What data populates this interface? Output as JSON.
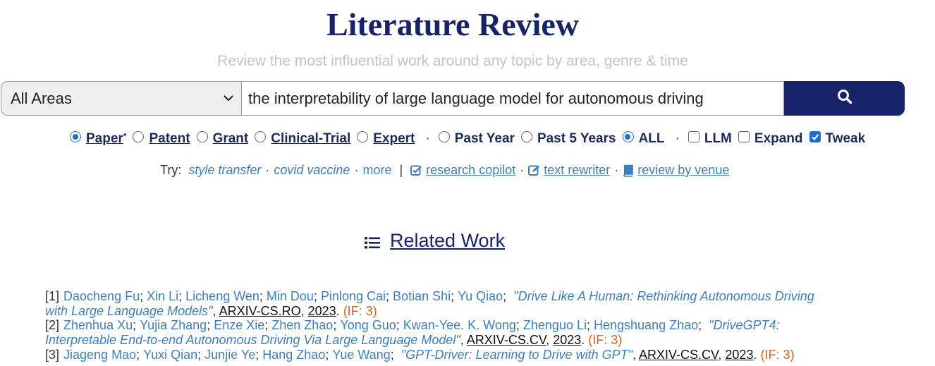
{
  "header": {
    "title": "Literature Review",
    "subtitle": "Review the most influential work around any topic by area, genre & time"
  },
  "search": {
    "area_selected": "All Areas",
    "query": "the interpretability of large language model for autonomous driving",
    "button_icon": "search-icon"
  },
  "options": {
    "paper": "Paper",
    "paper_mark": "*",
    "patent": "Patent",
    "grant": "Grant",
    "clinical_trial": "Clinical-Trial",
    "expert": "Expert",
    "sep": "·",
    "past_year": "Past Year",
    "past_5_years": "Past 5 Years",
    "all": "ALL",
    "sep2": "·",
    "llm": "LLM",
    "expand": "Expand",
    "tweak": "Tweak",
    "selected_genre": "Paper",
    "selected_time": "ALL",
    "llm_checked": false,
    "expand_checked": false,
    "tweak_checked": true
  },
  "try": {
    "label": "Try:",
    "ex1": "style transfer",
    "ex2": "covid vaccine",
    "more": "more",
    "dot": "·",
    "pipe": "|",
    "tool1": "research copilot",
    "tool2": "text rewriter",
    "tool3": "review by venue"
  },
  "related_work": {
    "heading": "Related Work",
    "icon": "list-icon"
  },
  "references": [
    {
      "num": "[1]",
      "authors": [
        "Daocheng Fu",
        "Xin Li",
        "Licheng Wen",
        "Min Dou",
        "Pinlong Cai",
        "Botian Shi",
        "Yu Qiao"
      ],
      "title": "\"Drive Like A Human: Rethinking Autonomous Driving with Large Language Models\"",
      "venue": "ARXIV-CS.RO",
      "year": "2023",
      "impact": "(IF: 3)"
    },
    {
      "num": "[2]",
      "authors": [
        "Zhenhua Xu",
        "Yujia Zhang",
        "Enze Xie",
        "Zhen Zhao",
        "Yong Guo",
        "Kwan-Yee. K. Wong",
        "Zhenguo Li",
        "Hengshuang Zhao"
      ],
      "title": "\"DriveGPT4: Interpretable End-to-end Autonomous Driving Via Large Language Model\"",
      "venue": "ARXIV-CS.CV",
      "year": "2023",
      "impact": "(IF: 3)"
    },
    {
      "num": "[3]",
      "authors": [
        "Jiageng Mao",
        "Yuxi Qian",
        "Junjie Ye",
        "Hang Zhao",
        "Yue Wang"
      ],
      "title": "\"GPT-Driver: Learning to Drive with GPT\"",
      "venue": "ARXIV-CS.CV",
      "year": "2023",
      "impact": "(IF: 3)"
    }
  ]
}
